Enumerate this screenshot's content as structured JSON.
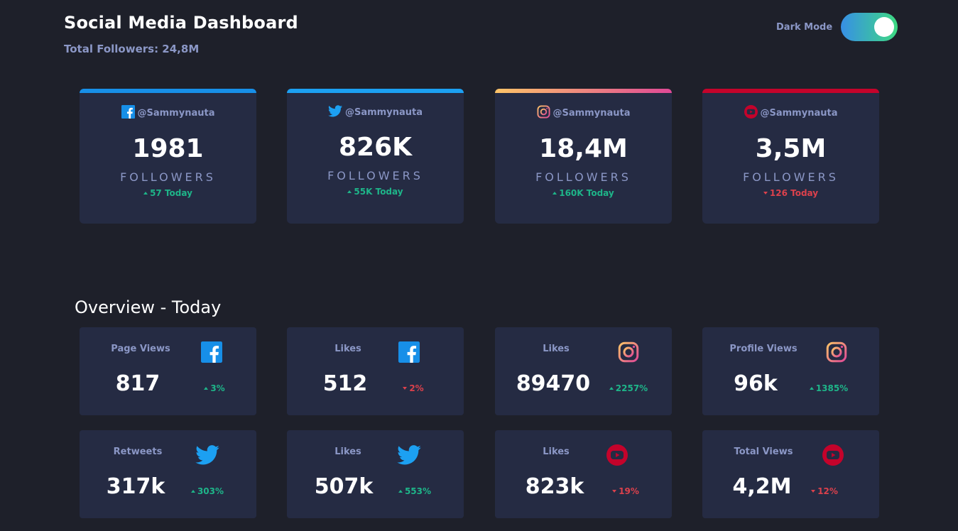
{
  "header": {
    "title": "Social Media Dashboard",
    "total_followers": "Total Followers: 24,8M",
    "mode_label": "Dark Mode",
    "dark_mode_on": true
  },
  "colors": {
    "facebook": "#178fe8",
    "twitter": "#1ca0f2",
    "instagram_start": "#fdc468",
    "instagram_end": "#df4996",
    "youtube": "#c4032b",
    "up": "#1eb589",
    "down": "#dc414c"
  },
  "cards": [
    {
      "platform": "facebook",
      "icon": "facebook-icon",
      "handle": "@Sammynauta",
      "count": "1981",
      "label": "FOLLOWERS",
      "today": "57 Today",
      "trend": "up"
    },
    {
      "platform": "twitter",
      "icon": "twitter-icon",
      "handle": "@Sammynauta",
      "count": "826K",
      "label": "FOLLOWERS",
      "today": "55K Today",
      "trend": "up"
    },
    {
      "platform": "instagram",
      "icon": "instagram-icon",
      "handle": "@Sammynauta",
      "count": "18,4M",
      "label": "FOLLOWERS",
      "today": "160K Today",
      "trend": "up"
    },
    {
      "platform": "youtube",
      "icon": "youtube-icon",
      "handle": "@Sammynauta",
      "count": "3,5M",
      "label": "FOLLOWERS",
      "today": "126 Today",
      "trend": "down"
    }
  ],
  "overview": {
    "title": "Overview - Today",
    "items": [
      {
        "label": "Page Views",
        "icon": "facebook-icon",
        "value": "817",
        "pct": "3%",
        "trend": "up"
      },
      {
        "label": "Likes",
        "icon": "facebook-icon",
        "value": "512",
        "pct": "2%",
        "trend": "down"
      },
      {
        "label": "Likes",
        "icon": "instagram-icon",
        "value": "89470",
        "pct": "2257%",
        "trend": "up"
      },
      {
        "label": "Profile Views",
        "icon": "instagram-icon",
        "value": "96k",
        "pct": "1385%",
        "trend": "up"
      },
      {
        "label": "Retweets",
        "icon": "twitter-icon",
        "value": "317k",
        "pct": "303%",
        "trend": "up"
      },
      {
        "label": "Likes",
        "icon": "twitter-icon",
        "value": "507k",
        "pct": "553%",
        "trend": "up"
      },
      {
        "label": "Likes",
        "icon": "youtube-icon",
        "value": "823k",
        "pct": "19%",
        "trend": "down"
      },
      {
        "label": "Total Views",
        "icon": "youtube-icon",
        "value": "4,2M",
        "pct": "12%",
        "trend": "down"
      }
    ]
  }
}
